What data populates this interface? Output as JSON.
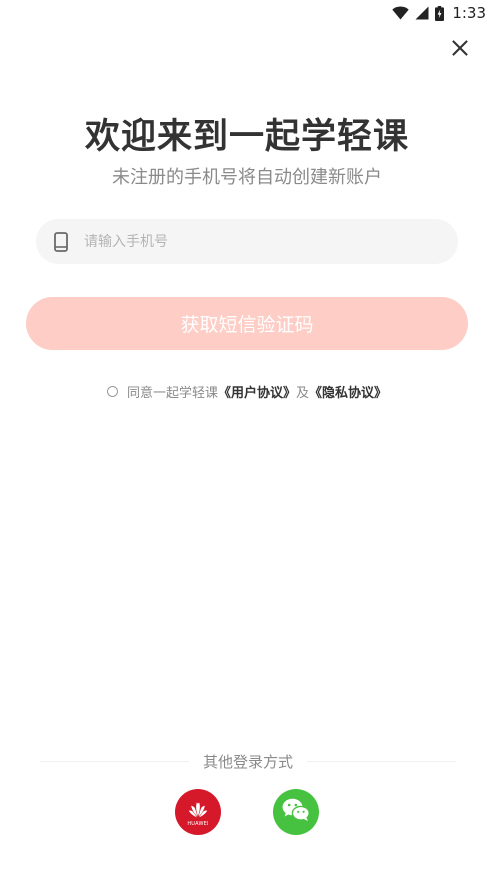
{
  "status_bar": {
    "time": "1:33",
    "icons": [
      "wifi-icon",
      "signal-icon",
      "battery-charging-icon"
    ]
  },
  "close_icon": "close-icon",
  "title": "欢迎来到一起学轻课",
  "subtitle": "未注册的手机号将自动创建新账户",
  "phone_input": {
    "icon": "phone-icon",
    "placeholder": "请输入手机号",
    "value": ""
  },
  "get_code_button": {
    "label": "获取短信验证码",
    "background": "#fdcdc6"
  },
  "agreement": {
    "prefix": "同意一起学轻课",
    "user_agreement": "《用户协议》",
    "conjunction": "及",
    "privacy_agreement": "《隐私协议》"
  },
  "other_login": {
    "label": "其他登录方式",
    "providers": [
      {
        "name": "huawei",
        "icon": "huawei-icon",
        "wordmark": "HUAWEI",
        "color": "#d5192a"
      },
      {
        "name": "wechat",
        "icon": "wechat-icon",
        "color": "#46c240"
      }
    ]
  }
}
